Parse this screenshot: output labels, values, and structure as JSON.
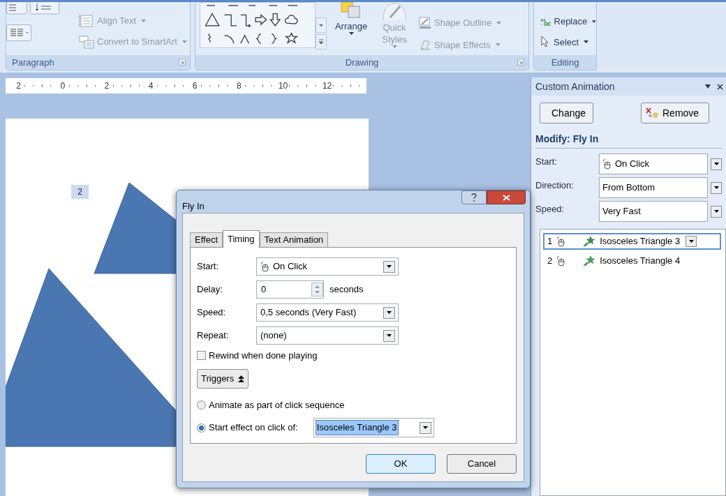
{
  "ribbon": {
    "groups": [
      {
        "kind": "paragraph",
        "label": "Paragraph",
        "items": [
          {
            "label": "Align Text",
            "disabled": true
          },
          {
            "label": "Convert to SmartArt",
            "disabled": true
          }
        ]
      },
      {
        "kind": "drawing",
        "label": "Drawing",
        "items": [
          {
            "label": "Arrange",
            "disabled": false
          },
          {
            "label": "Quick Styles",
            "disabled": true
          },
          {
            "label": "Shape Outline",
            "disabled": true
          },
          {
            "label": "Shape Effects",
            "disabled": true
          }
        ]
      },
      {
        "kind": "editing",
        "label": "Editing",
        "items": [
          {
            "label": "Replace",
            "disabled": false
          },
          {
            "label": "Select",
            "disabled": false
          }
        ]
      }
    ]
  },
  "ruler": {
    "labels": [
      "2",
      "0",
      "2",
      "4",
      "6",
      "8",
      "10",
      "12"
    ]
  },
  "slide": {
    "tag": "2"
  },
  "task_pane": {
    "title": "Custom Animation",
    "buttons": [
      "Change",
      "Remove"
    ],
    "heading": "Modify: Fly In",
    "fields": [
      {
        "kind": "mouse",
        "label": "Start:",
        "value": "On Click"
      },
      {
        "kind": "plain",
        "label": "Direction:",
        "value": "From Bottom"
      },
      {
        "kind": "plain",
        "label": "Speed:",
        "value": "Very Fast"
      }
    ],
    "list": [
      {
        "number": "1",
        "name": "Isosceles Triangle 3",
        "selected": true
      },
      {
        "number": "2",
        "name": "Isosceles Triangle 4",
        "selected": false
      }
    ]
  },
  "dialog": {
    "title": "Fly In",
    "tabs": [
      {
        "label": "Effect",
        "selected": false
      },
      {
        "label": "Timing",
        "selected": true
      },
      {
        "label": "Text Animation",
        "selected": false
      }
    ],
    "fields": [
      {
        "kind": "mouse",
        "label": "Start:",
        "value": "On Click"
      },
      {
        "kind": "spinner",
        "label": "Delay:",
        "value": "0",
        "unit": "seconds"
      },
      {
        "kind": "select",
        "label": "Speed:",
        "value": "0,5 seconds (Very Fast)"
      },
      {
        "kind": "select",
        "label": "Repeat:",
        "value": "(none)"
      }
    ],
    "rewind": {
      "label": "Rewind when done playing",
      "checked": false
    },
    "triggers_button": "Triggers",
    "trigger_options": [
      {
        "label": "Animate as part of click sequence",
        "selected": false
      },
      {
        "label": "Start effect on click of:",
        "selected": true,
        "value": "Isosceles Triangle 3"
      }
    ],
    "buttons": [
      {
        "label": "OK",
        "default": true
      },
      {
        "label": "Cancel",
        "default": false
      }
    ]
  }
}
